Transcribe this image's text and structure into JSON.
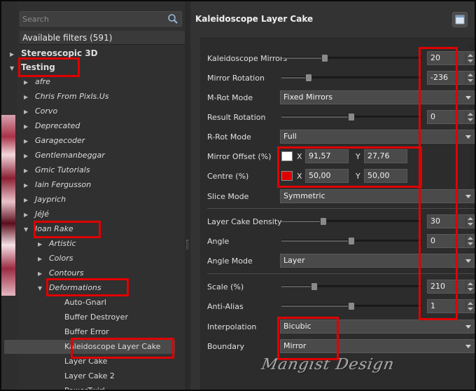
{
  "search": {
    "placeholder": "Search"
  },
  "filters_header": "Available filters (591)",
  "tree": {
    "stereoscopic": "Stereoscopic 3D",
    "testing": "Testing",
    "afre": "afre",
    "chris": "Chris From Pixls.Us",
    "corvo": "Corvo",
    "deprecated": "Deprecated",
    "garagecoder": "Garagecoder",
    "gentlemanbeggar": "Gentlemanbeggar",
    "gmic_tutorials": "Gmic Tutorials",
    "iain": "Iain Fergusson",
    "jayprich": "Jayprich",
    "jeje": "JéJé",
    "joan_rake": "Joan Rake",
    "artistic": "Artistic",
    "colors": "Colors",
    "contours": "Contours",
    "deformations": "Deformations",
    "auto_gnarl": "Auto-Gnarl",
    "buffer_destroyer": "Buffer Destroyer",
    "buffer_error": "Buffer Error",
    "kaleidoscope_layer_cake": "Kaleidoscope Layer Cake",
    "layer_cake": "Layer Cake",
    "layer_cake_2": "Layer Cake 2",
    "power_twirl": "PowerTwirl"
  },
  "filter_title": "Kaleidoscope Layer Cake",
  "params": {
    "kaleidoscope_mirrors": {
      "label": "Kaleidoscope Mirrors",
      "value": "20",
      "fraction": 0.3
    },
    "mirror_rotation": {
      "label": "Mirror Rotation",
      "value": "-236",
      "fraction": 0.18
    },
    "m_rot_mode": {
      "label": "M-Rot Mode",
      "value": "Fixed Mirrors"
    },
    "result_rotation": {
      "label": "Result Rotation",
      "value": "0",
      "fraction": 0.5
    },
    "r_rot_mode": {
      "label": "R-Rot Mode",
      "value": "Full"
    },
    "mirror_offset": {
      "label": "Mirror Offset (%)",
      "x_label": "X",
      "x": "91,57",
      "y_label": "Y",
      "y": "27,76",
      "color": "#ffffff"
    },
    "centre": {
      "label": "Centre (%)",
      "x_label": "X",
      "x": "50,00",
      "y_label": "Y",
      "y": "50,00",
      "color": "#e00000"
    },
    "slice_mode": {
      "label": "Slice Mode",
      "value": "Symmetric"
    },
    "layer_cake_density": {
      "label": "Layer Cake Density",
      "value": "30",
      "fraction": 0.29
    },
    "angle": {
      "label": "Angle",
      "value": "0",
      "fraction": 0.5
    },
    "angle_mode": {
      "label": "Angle Mode",
      "value": "Layer"
    },
    "scale": {
      "label": "Scale (%)",
      "value": "210",
      "fraction": 0.22
    },
    "anti_alias": {
      "label": "Anti-Alias",
      "value": "1",
      "fraction": 0.5
    },
    "interpolation": {
      "label": "Interpolation",
      "value": "Bicubic"
    },
    "boundary": {
      "label": "Boundary",
      "value": "Mirror"
    }
  },
  "watermark": "Mangist Design",
  "colors": {
    "highlight_box": "#e00000",
    "panel_bg": "#333333",
    "tree_bg": "#303030"
  }
}
